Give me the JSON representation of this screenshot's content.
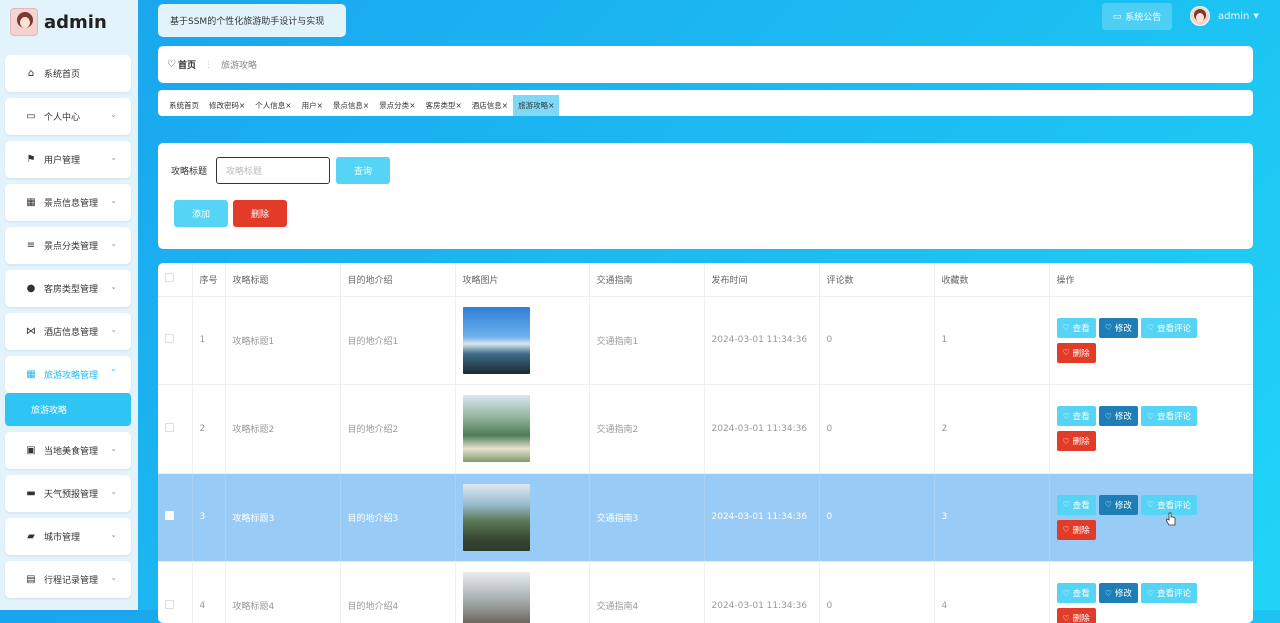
{
  "app": {
    "user_name": "admin",
    "system_title": "基于SSM的个性化旅游助手设计与实现",
    "notice_label": "系统公告",
    "user_menu": "admin"
  },
  "sidebar": {
    "items": [
      {
        "label": "系统首页",
        "icon": "home-icon",
        "glyph": "⌂"
      },
      {
        "label": "个人中心",
        "icon": "card-icon",
        "glyph": "▭"
      },
      {
        "label": "用户管理",
        "icon": "flag-icon",
        "glyph": "⚑"
      },
      {
        "label": "景点信息管理",
        "icon": "grid-icon",
        "glyph": "▦"
      },
      {
        "label": "景点分类管理",
        "icon": "sliders-icon",
        "glyph": "≡"
      },
      {
        "label": "客房类型管理",
        "icon": "pin-icon",
        "glyph": "●"
      },
      {
        "label": "酒店信息管理",
        "icon": "bowtie-icon",
        "glyph": "⋈"
      },
      {
        "label": "旅游攻略管理",
        "icon": "grid-icon",
        "glyph": "▦"
      },
      {
        "label": "当地美食管理",
        "icon": "trash-icon",
        "glyph": "▣"
      },
      {
        "label": "天气预报管理",
        "icon": "monitor-icon",
        "glyph": "▬"
      },
      {
        "label": "城市管理",
        "icon": "briefcase-icon",
        "glyph": "▰"
      },
      {
        "label": "行程记录管理",
        "icon": "list-icon",
        "glyph": "▤"
      }
    ],
    "submenu_label": "旅游攻略"
  },
  "breadcrumb": {
    "home": "首页",
    "current": "旅游攻略"
  },
  "tabs": [
    "系统首页",
    "修改密码",
    "个人信息",
    "用户",
    "景点信息",
    "景点分类",
    "客房类型",
    "酒店信息",
    "旅游攻略"
  ],
  "search": {
    "label": "攻略标题",
    "placeholder": "攻略标题",
    "query_btn": "查询",
    "add_btn": "添加",
    "delete_btn": "删除"
  },
  "table": {
    "headers": [
      "序号",
      "攻略标题",
      "目的地介绍",
      "攻略图片",
      "交通指南",
      "发布时间",
      "评论数",
      "收藏数",
      "操作"
    ],
    "actions": {
      "view": "查看",
      "edit": "修改",
      "comments": "查看评论",
      "delete": "删除"
    },
    "rows": [
      {
        "no": "1",
        "title": "攻略标题1",
        "intro": "目的地介绍1",
        "traffic": "交通指南1",
        "time": "2024-03-01 11:34:36",
        "comments": "0",
        "favorites": "1"
      },
      {
        "no": "2",
        "title": "攻略标题2",
        "intro": "目的地介绍2",
        "traffic": "交通指南2",
        "time": "2024-03-01 11:34:36",
        "comments": "0",
        "favorites": "2"
      },
      {
        "no": "3",
        "title": "攻略标题3",
        "intro": "目的地介绍3",
        "traffic": "交通指南3",
        "time": "2024-03-01 11:34:36",
        "comments": "0",
        "favorites": "3"
      },
      {
        "no": "4",
        "title": "攻略标题4",
        "intro": "目的地介绍4",
        "traffic": "交通指南4",
        "time": "2024-03-01 11:34:36",
        "comments": "0",
        "favorites": "4"
      }
    ]
  },
  "colors": {
    "accent": "#55d4f5",
    "edit": "#1d7fb5",
    "danger": "#e23c28",
    "selected_row": "#98ccf7"
  }
}
